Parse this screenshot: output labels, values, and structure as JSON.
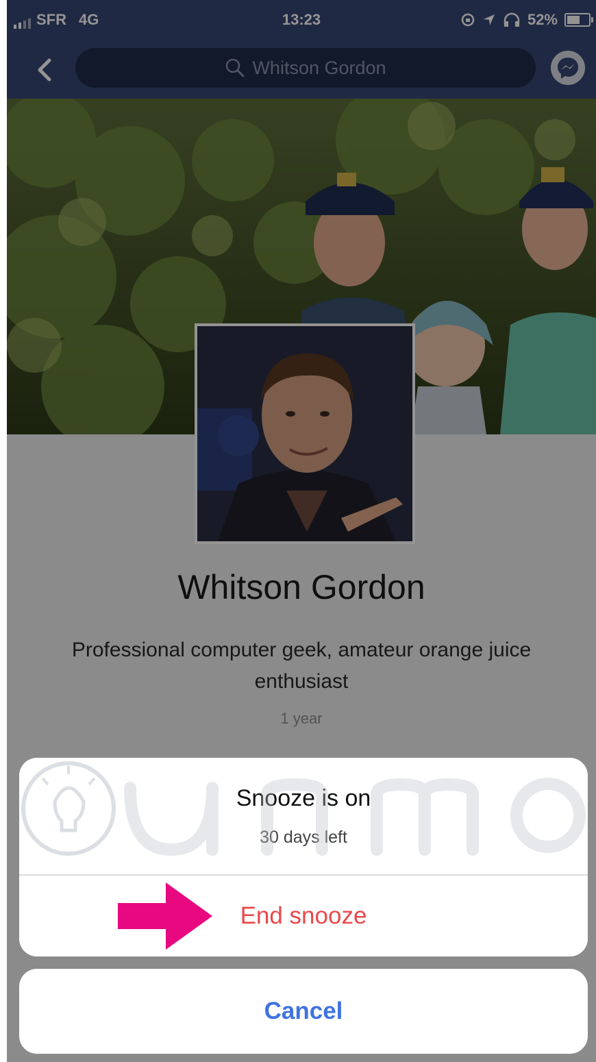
{
  "status_bar": {
    "carrier": "SFR",
    "network": "4G",
    "time": "13:23",
    "battery": "52%",
    "battery_level": 0.52
  },
  "nav": {
    "search_text": "Whitson Gordon",
    "back_icon": "chevron-left-icon",
    "search_icon": "search-icon",
    "messenger_icon": "messenger-icon"
  },
  "profile": {
    "name": "Whitson Gordon",
    "bio": "Professional computer geek, amateur orange juice enthusiast",
    "time": "1 year"
  },
  "snooze_sheet": {
    "title": "Snooze is on",
    "subtitle": "30 days left",
    "end_label": "End snooze",
    "cancel_label": "Cancel"
  },
  "watermark_text": "Quantrimang",
  "colors": {
    "header": "#374874",
    "destructive": "#e8484a",
    "link": "#3f73e0",
    "arrow": "#e8087f"
  }
}
